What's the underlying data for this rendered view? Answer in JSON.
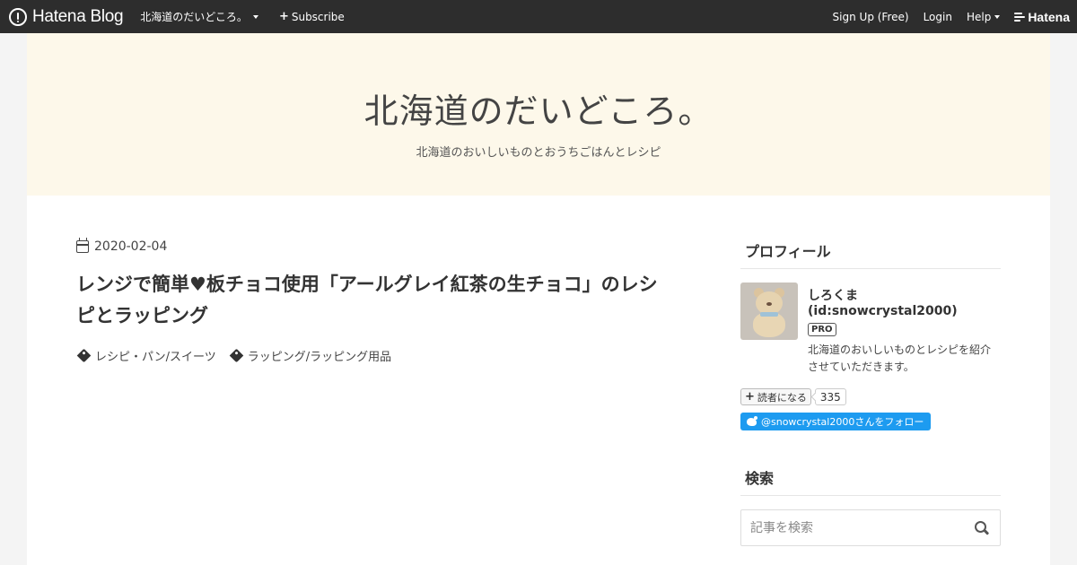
{
  "topbar": {
    "logo_text": "Hatena Blog",
    "blog_menu_label": "北海道のだいどころ。",
    "subscribe_label": "Subscribe",
    "signup_label": "Sign Up (Free)",
    "login_label": "Login",
    "help_label": "Help",
    "brand_label": "Hatena"
  },
  "header": {
    "title": "北海道のだいどころ。",
    "description": "北海道のおいしいものとおうちごはんとレシピ"
  },
  "article": {
    "date": "2020-02-04",
    "title": "レンジで簡単♥板チョコ使用「アールグレイ紅茶の生チョコ」のレシピとラッピング",
    "categories": [
      "レシピ・パン/スイーツ",
      "ラッピング/ラッピング用品"
    ]
  },
  "sidebar": {
    "profile_title": "プロフィール",
    "profile_name": "しろくま (id:snowcrystal2000)",
    "pro_badge": "PRO",
    "profile_description": "北海道のおいしいものとレシピを紹介させていただきます。",
    "reader_button_label": "読者になる",
    "reader_count": "335",
    "twitter_follow_label": "@snowcrystal2000さんをフォロー",
    "search_title": "検索",
    "search_placeholder": "記事を検索"
  },
  "colors": {
    "topbar_bg": "#2d2d2d",
    "header_bg": "#fdf8ea",
    "twitter_blue": "#1d9bf0"
  },
  "icons": [
    "hatena-logo-icon",
    "caret-down-icon",
    "plus-icon",
    "hatena-wind-icon",
    "calendar-icon",
    "tag-icon",
    "twitter-bird-icon",
    "search-icon"
  ]
}
